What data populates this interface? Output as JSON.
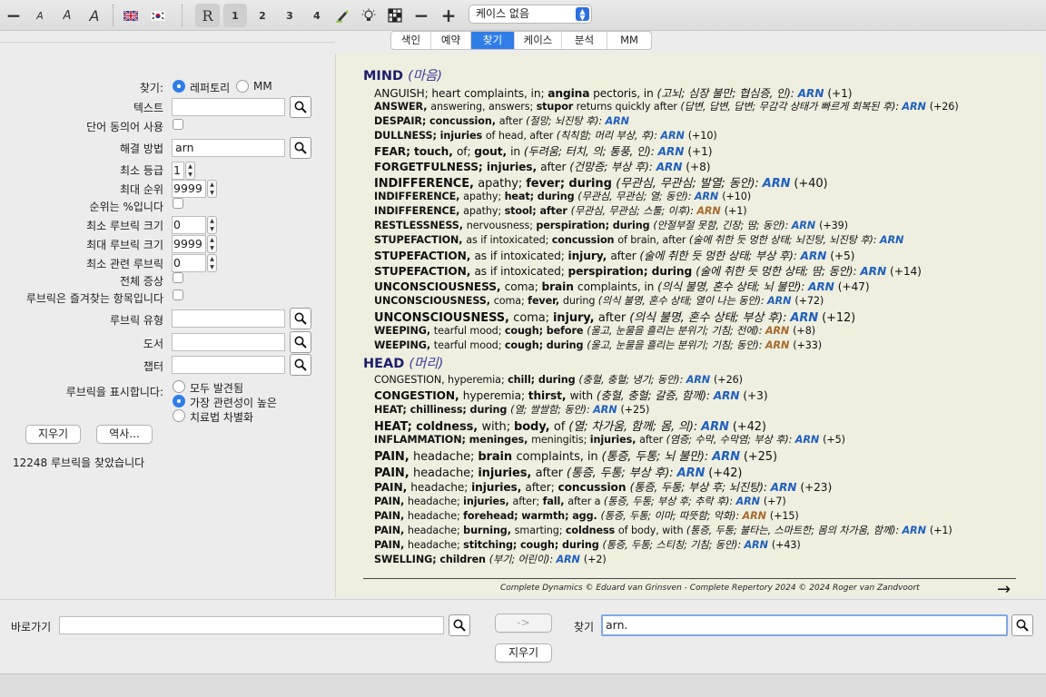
{
  "toolbar": {
    "zoom_out": "−",
    "font_small": "A",
    "font_medium": "A",
    "font_large": "A",
    "font_xlarge": "A",
    "r_label": "R",
    "levels": [
      "1",
      "2",
      "3",
      "4"
    ],
    "minus": "−",
    "plus": "+",
    "case_select_value": "케이스 없음"
  },
  "tabs": [
    {
      "label": "색인",
      "active": false
    },
    {
      "label": "예약",
      "active": false
    },
    {
      "label": "찾기",
      "active": true
    },
    {
      "label": "케이스",
      "active": false
    },
    {
      "label": "분석",
      "active": false
    },
    {
      "label": "MM",
      "active": false
    }
  ],
  "search_form": {
    "find_label": "찾기:",
    "find_options": [
      "레퍼토리",
      "MM"
    ],
    "find_selected": "레퍼토리",
    "text_label": "텍스트",
    "text_value": "",
    "synonyms_label": "단어 동의어 사용",
    "remedy_label": "해결 방법",
    "remedy_value": "arn",
    "min_grade_label": "최소 등급",
    "min_grade_value": "1",
    "max_rank_label": "최대 순위",
    "max_rank_value": "9999",
    "rank_pct_label": "순위는 %입니다",
    "min_rubric_size_label": "최소 루브릭 크기",
    "min_rubric_size_value": "0",
    "max_rubric_size_label": "최대 루브릭 크기",
    "max_rubric_size_value": "9999",
    "min_related_label": "최소 관련 루브릭",
    "min_related_value": "0",
    "all_symptoms_label": "전체 증상",
    "favorites_label": "루브릭은 즐겨찾는 항목입니다",
    "rubric_type_label": "루브릭 유형",
    "book_label": "도서",
    "chapter_label": "챕터",
    "show_rubrics_label": "루브릭을 표시합니다:",
    "show_options": [
      "모두 발견됨",
      "가장 관련성이 높은",
      "치료법 차별화"
    ],
    "show_selected": "가장 관련성이 높은",
    "clear_button": "지우기",
    "reverse_button": "역사...",
    "result_count": "12248 루브릭을 찾았습니다"
  },
  "results": {
    "chapters": [
      {
        "name": "MIND",
        "translation": "(마음)"
      },
      {
        "name": "HEAD",
        "translation": "(머리)"
      }
    ],
    "mind_rubrics": [
      {
        "parts": [
          [
            "n",
            "ANGUISH; heart complaints, in; "
          ],
          [
            "b",
            "angina"
          ],
          [
            "n",
            " pectoris, in "
          ],
          [
            "i",
            "(고뇌; 심장 불만; 협심증, 인): "
          ]
        ],
        "remedy": "ARN",
        "brown": false,
        "extra": "(+1)",
        "size": "s-mid"
      },
      {
        "parts": [
          [
            "b",
            "ANSWER, "
          ],
          [
            "n",
            "answering, answers; "
          ],
          [
            "b",
            "stupor"
          ],
          [
            "n",
            " returns quickly after "
          ],
          [
            "i",
            "(답변, 답변, 답변; 무감각 상태가 빠르게 회복된 후): "
          ]
        ],
        "remedy": "ARN",
        "brown": false,
        "extra": "(+26)",
        "size": "s-sm"
      },
      {
        "parts": [
          [
            "b",
            "DESPAIR; concussion, "
          ],
          [
            "n",
            "after "
          ],
          [
            "i",
            "(절망; 뇌진탕 후): "
          ]
        ],
        "remedy": "ARN",
        "brown": false,
        "extra": "",
        "size": "s-sm"
      },
      {
        "parts": [
          [
            "b",
            "DULLNESS; injuries "
          ],
          [
            "n",
            "of head, after "
          ],
          [
            "i",
            "(칙칙함; 머리 부상, 후): "
          ]
        ],
        "remedy": "ARN",
        "brown": false,
        "extra": "(+10)",
        "size": "s-sm"
      },
      {
        "parts": [
          [
            "b",
            "FEAR; touch, "
          ],
          [
            "n",
            "of; "
          ],
          [
            "b",
            "gout, "
          ],
          [
            "n",
            "in "
          ],
          [
            "i",
            "(두려움; 터치, 의; 통풍, 인): "
          ]
        ],
        "remedy": "ARN",
        "brown": false,
        "extra": "(+1)",
        "size": "s-mid"
      },
      {
        "parts": [
          [
            "b",
            "FORGETFULNESS; injuries, "
          ],
          [
            "n",
            "after "
          ],
          [
            "i",
            "(건망증; 부상 후): "
          ]
        ],
        "remedy": "ARN",
        "brown": false,
        "extra": "(+8)",
        "size": "s-mid"
      },
      {
        "parts": [
          [
            "b",
            "INDIFFERENCE, "
          ],
          [
            "n",
            "apathy; "
          ],
          [
            "b",
            "fever; during "
          ],
          [
            "i",
            "(무관심, 무관심; 발열; 동안): "
          ]
        ],
        "remedy": "ARN",
        "brown": false,
        "extra": "(+40)",
        "size": "s-big"
      },
      {
        "parts": [
          [
            "b",
            "INDIFFERENCE, "
          ],
          [
            "n",
            "apathy; "
          ],
          [
            "b",
            "heat; during "
          ],
          [
            "i",
            "(무관심, 무관심; 열; 동안): "
          ]
        ],
        "remedy": "ARN",
        "brown": false,
        "extra": "(+10)",
        "size": "s-sm"
      },
      {
        "parts": [
          [
            "b",
            "INDIFFERENCE, "
          ],
          [
            "n",
            "apathy; "
          ],
          [
            "b",
            "stool; after "
          ],
          [
            "i",
            "(무관심, 무관심; 스툴; 이후): "
          ]
        ],
        "remedy": "ARN",
        "brown": true,
        "extra": "(+1)",
        "size": "s-sm"
      },
      {
        "parts": [
          [
            "b",
            "RESTLESSNESS, "
          ],
          [
            "n",
            "nervousness; "
          ],
          [
            "b",
            "perspiration; during "
          ],
          [
            "i",
            "(안절부절 못함, 긴장; 땀; 동안): "
          ]
        ],
        "remedy": "ARN",
        "brown": false,
        "extra": "(+39)",
        "size": "s-sm"
      },
      {
        "parts": [
          [
            "b",
            "STUPEFACTION, "
          ],
          [
            "n",
            "as if intoxicated; "
          ],
          [
            "b",
            "concussion "
          ],
          [
            "n",
            "of brain, after "
          ],
          [
            "i",
            "(술에 취한 듯 멍한 상태; 뇌진탕, 뇌진탕 후): "
          ]
        ],
        "remedy": "ARN",
        "brown": false,
        "extra": "",
        "size": "s-sm"
      },
      {
        "parts": [
          [
            "b",
            "STUPEFACTION, "
          ],
          [
            "n",
            "as if intoxicated; "
          ],
          [
            "b",
            "injury, "
          ],
          [
            "n",
            "after "
          ],
          [
            "i",
            "(술에 취한 듯 멍한 상태; 부상 후): "
          ]
        ],
        "remedy": "ARN",
        "brown": false,
        "extra": "(+5)",
        "size": "s-mid"
      },
      {
        "parts": [
          [
            "b",
            "STUPEFACTION, "
          ],
          [
            "n",
            "as if intoxicated; "
          ],
          [
            "b",
            "perspiration; during "
          ],
          [
            "i",
            "(술에 취한 듯 멍한 상태; 땀; 동안): "
          ]
        ],
        "remedy": "ARN",
        "brown": false,
        "extra": "(+14)",
        "size": "s-mid"
      },
      {
        "parts": [
          [
            "b",
            "UNCONSCIOUSNESS, "
          ],
          [
            "n",
            "coma; "
          ],
          [
            "b",
            "brain "
          ],
          [
            "n",
            "complaints, in "
          ],
          [
            "i",
            "(의식 불명, 혼수 상태; 뇌 불만): "
          ]
        ],
        "remedy": "ARN",
        "brown": false,
        "extra": "(+47)",
        "size": "s-mid"
      },
      {
        "parts": [
          [
            "b",
            "UNCONSCIOUSNESS, "
          ],
          [
            "n",
            "coma; "
          ],
          [
            "b",
            "fever, "
          ],
          [
            "n",
            "during "
          ],
          [
            "i",
            "(의식 불명, 혼수 상태; 열이 나는 동안): "
          ]
        ],
        "remedy": "ARN",
        "brown": false,
        "extra": "(+72)",
        "size": "s-sm"
      },
      {
        "parts": [
          [
            "b",
            "UNCONSCIOUSNESS, "
          ],
          [
            "n",
            "coma; "
          ],
          [
            "b",
            "injury, "
          ],
          [
            "n",
            "after "
          ],
          [
            "i",
            "(의식 불명, 혼수 상태; 부상 후): "
          ]
        ],
        "remedy": "ARN",
        "brown": false,
        "extra": "(+12)",
        "size": "s-big"
      },
      {
        "parts": [
          [
            "b",
            "WEEPING, "
          ],
          [
            "n",
            "tearful mood; "
          ],
          [
            "b",
            "cough; before "
          ],
          [
            "i",
            "(울고, 눈물을 흘리는 분위기; 기침; 전에): "
          ]
        ],
        "remedy": "ARN",
        "brown": true,
        "extra": "(+8)",
        "size": "s-sm"
      },
      {
        "parts": [
          [
            "b",
            "WEEPING, "
          ],
          [
            "n",
            "tearful mood; "
          ],
          [
            "b",
            "cough; during "
          ],
          [
            "i",
            "(울고, 눈물을 흘리는 분위기; 기침; 동안): "
          ]
        ],
        "remedy": "ARN",
        "brown": true,
        "extra": "(+33)",
        "size": "s-sm"
      }
    ],
    "head_rubrics": [
      {
        "parts": [
          [
            "n",
            "CONGESTION, hyperemia; "
          ],
          [
            "b",
            "chill; during "
          ],
          [
            "i",
            "(충혈, 충혈; 냉기; 동안): "
          ]
        ],
        "remedy": "ARN",
        "brown": false,
        "extra": "(+26)",
        "size": "s-sm"
      },
      {
        "parts": [
          [
            "b",
            "CONGESTION, "
          ],
          [
            "n",
            "hyperemia; "
          ],
          [
            "b",
            "thirst, "
          ],
          [
            "n",
            "with "
          ],
          [
            "i",
            "(충혈, 충혈; 갈증, 함께): "
          ]
        ],
        "remedy": "ARN",
        "brown": false,
        "extra": "(+3)",
        "size": "s-mid"
      },
      {
        "parts": [
          [
            "b",
            "HEAT; chilliness; during "
          ],
          [
            "i",
            "(열; 쌀쌀함; 동안): "
          ]
        ],
        "remedy": "ARN",
        "brown": false,
        "extra": "(+25)",
        "size": "s-sm"
      },
      {
        "parts": [
          [
            "b",
            "HEAT; coldness, "
          ],
          [
            "n",
            "with; "
          ],
          [
            "b",
            "body, "
          ],
          [
            "n",
            "of "
          ],
          [
            "i",
            "(열; 차가움, 함께; 몸, 의): "
          ]
        ],
        "remedy": "ARN",
        "brown": false,
        "extra": "(+42)",
        "size": "s-big"
      },
      {
        "parts": [
          [
            "b",
            "INFLAMMATION; meninges, "
          ],
          [
            "n",
            "meningitis; "
          ],
          [
            "b",
            "injuries, "
          ],
          [
            "n",
            "after "
          ],
          [
            "i",
            "(염증; 수막, 수막염; 부상 후): "
          ]
        ],
        "remedy": "ARN",
        "brown": false,
        "extra": "(+5)",
        "size": "s-sm"
      },
      {
        "parts": [
          [
            "b",
            "PAIN, "
          ],
          [
            "n",
            "headache; "
          ],
          [
            "b",
            "brain "
          ],
          [
            "n",
            "complaints, in "
          ],
          [
            "i",
            "(통증, 두통; 뇌 불만): "
          ]
        ],
        "remedy": "ARN",
        "brown": false,
        "extra": "(+25)",
        "size": "s-big"
      },
      {
        "parts": [
          [
            "b",
            "PAIN, "
          ],
          [
            "n",
            "headache; "
          ],
          [
            "b",
            "injuries, "
          ],
          [
            "n",
            "after "
          ],
          [
            "i",
            "(통증, 두통; 부상 후): "
          ]
        ],
        "remedy": "ARN",
        "brown": false,
        "extra": "(+42)",
        "size": "s-big"
      },
      {
        "parts": [
          [
            "b",
            "PAIN, "
          ],
          [
            "n",
            "headache; "
          ],
          [
            "b",
            "injuries, "
          ],
          [
            "n",
            "after; "
          ],
          [
            "b",
            "concussion "
          ],
          [
            "i",
            "(통증, 두통; 부상 후; 뇌진탕): "
          ]
        ],
        "remedy": "ARN",
        "brown": false,
        "extra": "(+23)",
        "size": "s-mid"
      },
      {
        "parts": [
          [
            "b",
            "PAIN, "
          ],
          [
            "n",
            "headache; "
          ],
          [
            "b",
            "injuries, "
          ],
          [
            "n",
            "after; "
          ],
          [
            "b",
            "fall, "
          ],
          [
            "n",
            "after a "
          ],
          [
            "i",
            "(통증, 두통; 부상 후; 추락 후): "
          ]
        ],
        "remedy": "ARN",
        "brown": false,
        "extra": "(+7)",
        "size": "s-sm"
      },
      {
        "parts": [
          [
            "b",
            "PAIN, "
          ],
          [
            "n",
            "headache; "
          ],
          [
            "b",
            "forehead; warmth; agg. "
          ],
          [
            "i",
            "(통증, 두통; 이마; 따뜻함; 악화): "
          ]
        ],
        "remedy": "ARN",
        "brown": true,
        "extra": "(+15)",
        "size": "s-sm"
      },
      {
        "parts": [
          [
            "b",
            "PAIN, "
          ],
          [
            "n",
            "headache; "
          ],
          [
            "b",
            "burning, "
          ],
          [
            "n",
            "smarting; "
          ],
          [
            "b",
            "coldness "
          ],
          [
            "n",
            "of body, with "
          ],
          [
            "i",
            "(통증, 두통; 불타는, 스마트한; 몸의 차가움, 함께): "
          ]
        ],
        "remedy": "ARN",
        "brown": false,
        "extra": "(+1)",
        "size": "s-sm"
      },
      {
        "parts": [
          [
            "b",
            "PAIN, "
          ],
          [
            "n",
            "headache; "
          ],
          [
            "b",
            "stitching; cough; during "
          ],
          [
            "i",
            "(통증, 두통; 스티칭; 기침; 동안): "
          ]
        ],
        "remedy": "ARN",
        "brown": false,
        "extra": "(+43)",
        "size": "s-sm"
      },
      {
        "parts": [
          [
            "b",
            "SWELLING; children "
          ],
          [
            "i",
            "(부기; 어린이): "
          ]
        ],
        "remedy": "ARN",
        "brown": false,
        "extra": "(+2)",
        "size": "s-sm"
      }
    ],
    "copyright": "Complete Dynamics © Eduard van Grinsven   -   Complete Repertory 2024 © 2024 Roger van Zandvoort",
    "next_arrow": "→"
  },
  "bottom": {
    "goto_label": "바로가기",
    "goto_value": "",
    "arrow_button": "->",
    "find_label": "찾기",
    "find_value": "arn.",
    "clear_button": "지우기"
  },
  "colors": {
    "accent": "#2f7ee8",
    "remedy_blue": "#1f5fbf",
    "remedy_brown": "#a66a2e",
    "chapter_navy": "#1d1d6f",
    "results_bg": "#efefdf"
  }
}
